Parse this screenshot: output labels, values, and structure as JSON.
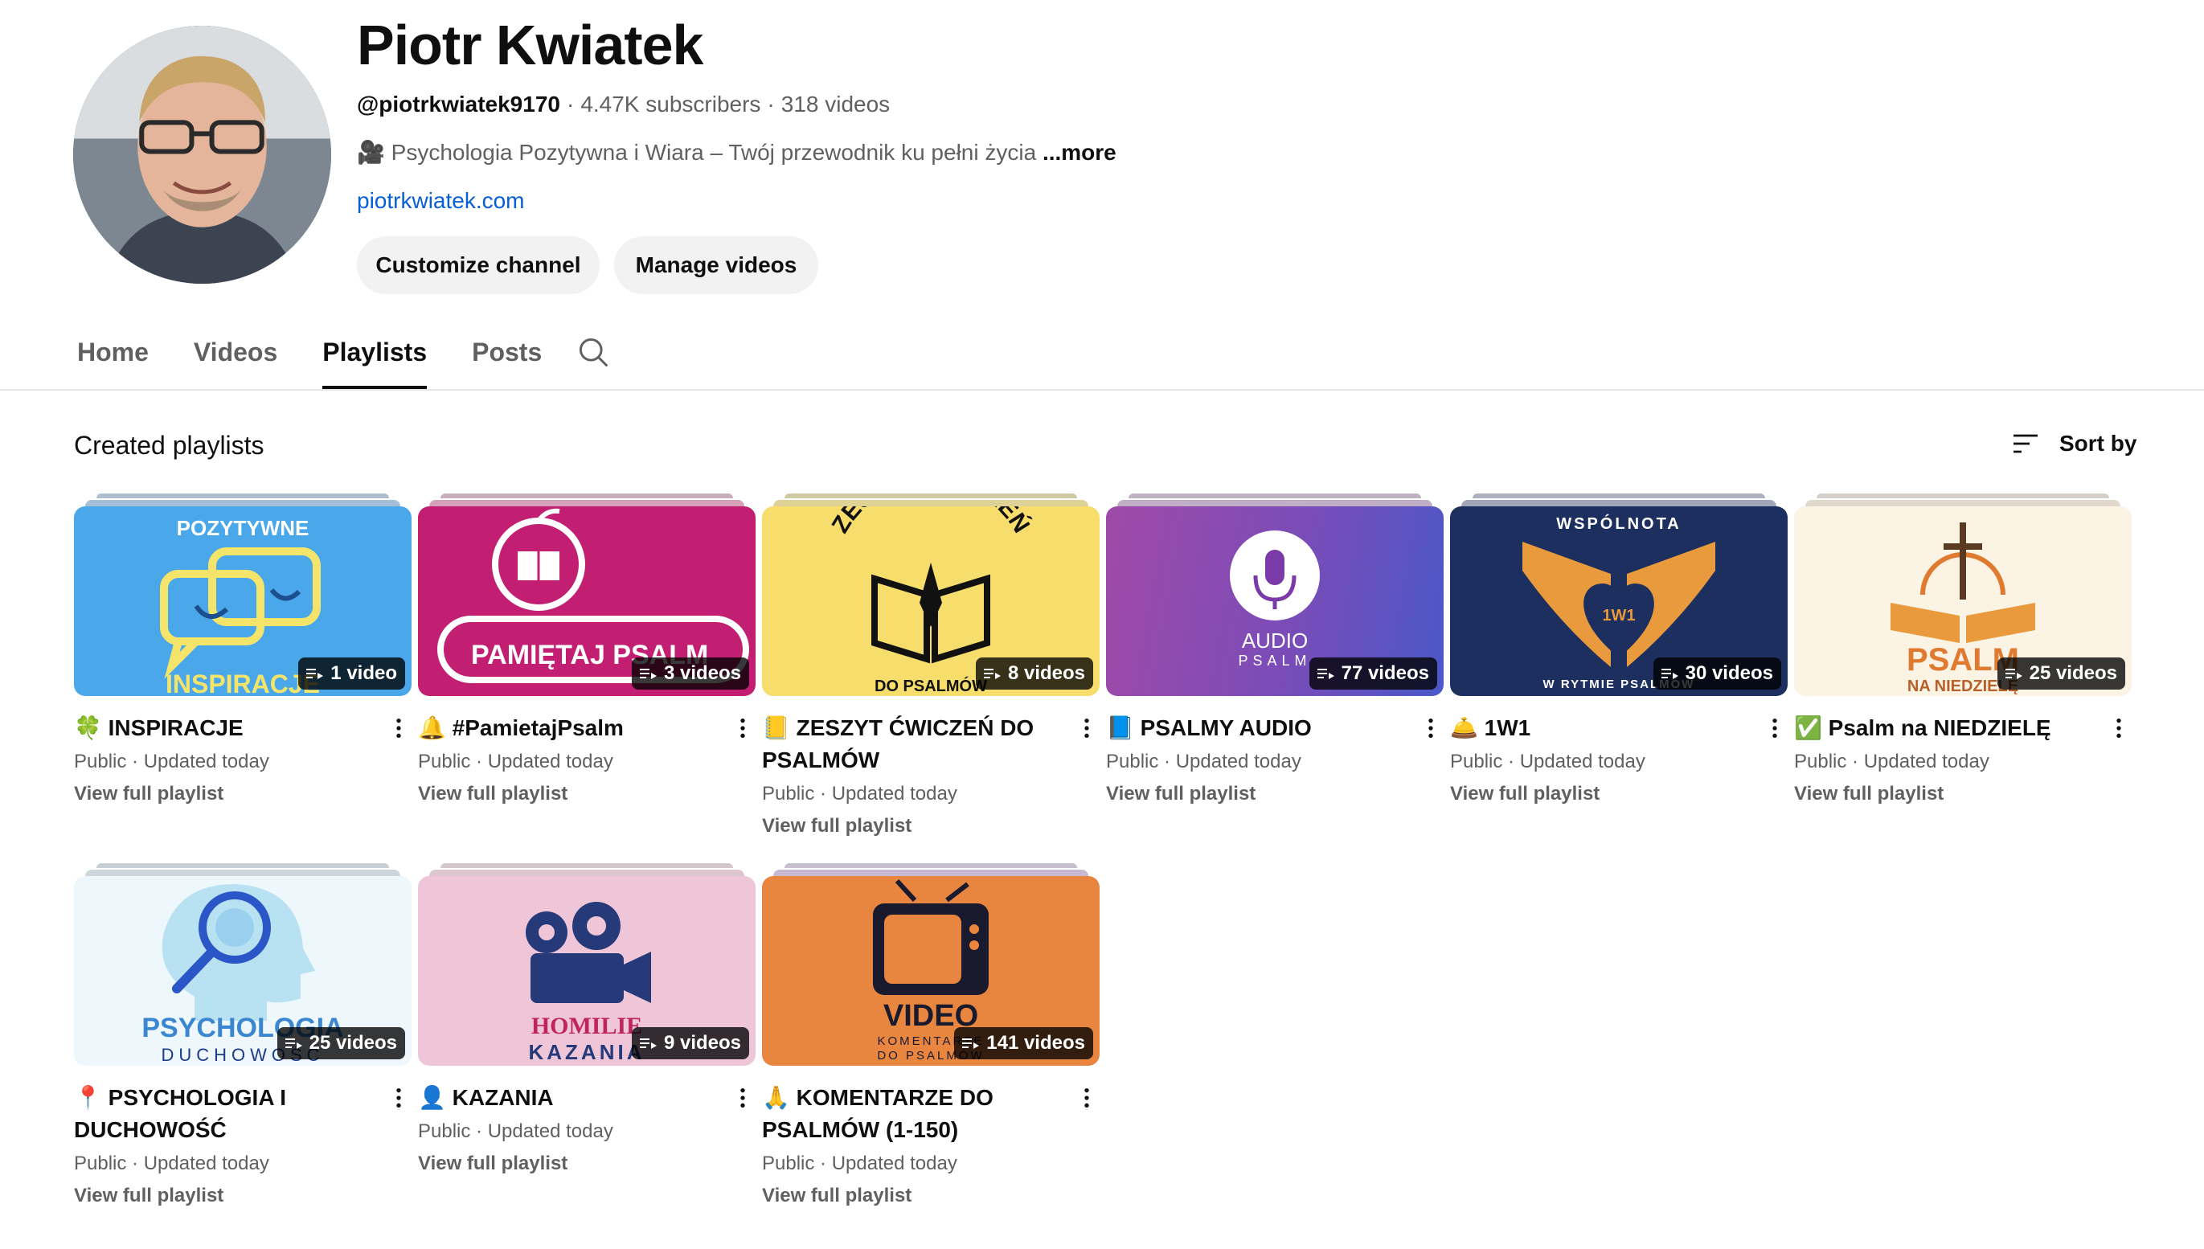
{
  "channel": {
    "name": "Piotr Kwiatek",
    "handle": "@piotrkwiatek9170",
    "subscribers": "4.47K subscribers",
    "videos": "318 videos",
    "description": "🎥 Psychologia Pozytywna i Wiara – Twój przewodnik ku pełni życia",
    "more_label": "...more",
    "link": "piotrkwiatek.com",
    "customize_label": "Customize channel",
    "manage_label": "Manage videos"
  },
  "tabs": [
    {
      "label": "Home",
      "active": false
    },
    {
      "label": "Videos",
      "active": false
    },
    {
      "label": "Playlists",
      "active": true
    },
    {
      "label": "Posts",
      "active": false
    }
  ],
  "icons": {
    "search": "search-icon",
    "sort": "sort-icon",
    "more": "more-vertical-icon",
    "playlist": "playlist-icon"
  },
  "section": {
    "title": "Created playlists",
    "sort_label": "Sort by"
  },
  "playlists": [
    {
      "title": "🍀 INSPIRACJE",
      "count": "1 video",
      "visibility": "Public",
      "updated": "Updated today",
      "view_label": "View full playlist",
      "thumb_color": "#4aa8ea",
      "thumb_text_top": "POZYTYWNE",
      "thumb_text_bottom": "INSPIRACJE"
    },
    {
      "title": "🔔 #PamietajPsalm",
      "count": "3 videos",
      "visibility": "Public",
      "updated": "Updated today",
      "view_label": "View full playlist",
      "thumb_color": "#c21f72",
      "thumb_text_bottom": "PAMIĘTAJ PSALM"
    },
    {
      "title": "📒 ZESZYT ĆWICZEŃ DO PSALMÓW",
      "count": "8 videos",
      "visibility": "Public",
      "updated": "Updated today",
      "view_label": "View full playlist",
      "thumb_color": "#f6dd6c",
      "thumb_text_top": "ZESZYT ĆWICZEŃ",
      "thumb_text_bottom": "DO PSALMÓW"
    },
    {
      "title": "📘 PSALMY AUDIO",
      "count": "77 videos",
      "visibility": "Public",
      "updated": "Updated today",
      "view_label": "View full playlist",
      "thumb_color": "#8a4fb8",
      "thumb_text_top": "AUDIO",
      "thumb_text_bottom": "PSALM"
    },
    {
      "title": "🛎️ 1W1",
      "count": "30 videos",
      "visibility": "Public",
      "updated": "Updated today",
      "view_label": "View full playlist",
      "thumb_color": "#1d2f5e",
      "thumb_text_top": "WSPÓLNOTA",
      "thumb_text_mid": "1W1",
      "thumb_text_bottom": "W RYTMIE PSALMÓW"
    },
    {
      "title": "✅ Psalm na NIEDZIELĘ",
      "count": "25 videos",
      "visibility": "Public",
      "updated": "Updated today",
      "view_label": "View full playlist",
      "thumb_color": "#fbf4e4",
      "thumb_text_top": "PSALM",
      "thumb_text_bottom": "NA NIEDZIELĘ"
    },
    {
      "title": "📍 PSYCHOLOGIA I DUCHOWOŚĆ",
      "count": "25 videos",
      "visibility": "Public",
      "updated": "Updated today",
      "view_label": "View full playlist",
      "thumb_color": "#eef7fb",
      "thumb_text_top": "PSYCHOLOGIA",
      "thumb_text_bottom": "DUCHOWOŚĆ"
    },
    {
      "title": "👤 KAZANIA",
      "count": "9 videos",
      "visibility": "Public",
      "updated": "Updated today",
      "view_label": "View full playlist",
      "thumb_color": "#eec6d8",
      "thumb_text_top": "HOMILIE",
      "thumb_text_bottom": "KAZANIA"
    },
    {
      "title": "🙏 KOMENTARZE DO PSALMÓW (1-150)",
      "count": "141 videos",
      "visibility": "Public",
      "updated": "Updated today",
      "view_label": "View full playlist",
      "thumb_color": "#e8853f",
      "thumb_text_top": "VIDEO",
      "thumb_text_mid": "KOMENTARZE",
      "thumb_text_bottom": "DO PSALMÓW"
    }
  ]
}
